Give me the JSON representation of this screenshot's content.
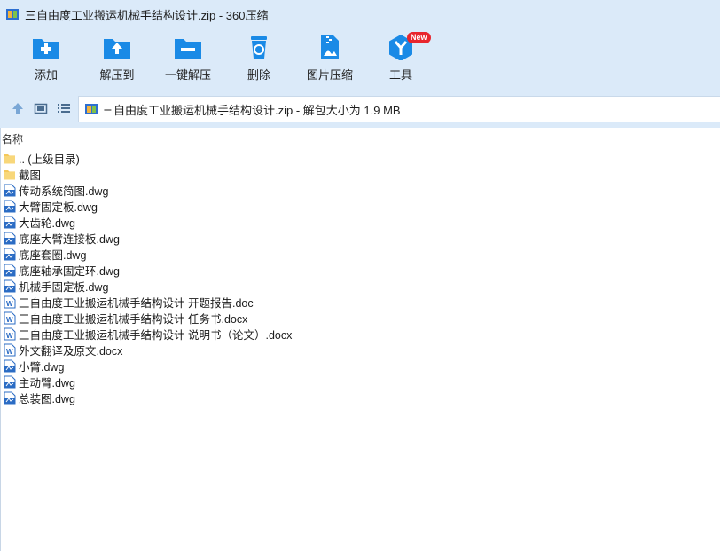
{
  "window": {
    "title": "三自由度工业搬运机械手结构设计.zip - 360压缩"
  },
  "toolbar": {
    "items": [
      {
        "label": "添加",
        "icon": "add-icon"
      },
      {
        "label": "解压到",
        "icon": "extract-to-icon"
      },
      {
        "label": "一键解压",
        "icon": "one-click-extract-icon"
      },
      {
        "label": "删除",
        "icon": "delete-icon"
      },
      {
        "label": "图片压缩",
        "icon": "image-compress-icon"
      },
      {
        "label": "工具",
        "icon": "tools-icon",
        "badge": "New"
      }
    ]
  },
  "address": {
    "text": "三自由度工业搬运机械手结构设计.zip - 解包大小为 1.9 MB"
  },
  "list": {
    "column_name": "名称",
    "files": [
      {
        "name": ".. (上级目录)",
        "type": "folder"
      },
      {
        "name": "截图",
        "type": "folder"
      },
      {
        "name": "传动系统简图.dwg",
        "type": "dwg"
      },
      {
        "name": "大臂固定板.dwg",
        "type": "dwg"
      },
      {
        "name": "大齿轮.dwg",
        "type": "dwg"
      },
      {
        "name": "底座大臂连接板.dwg",
        "type": "dwg"
      },
      {
        "name": "底座套圈.dwg",
        "type": "dwg"
      },
      {
        "name": "底座轴承固定环.dwg",
        "type": "dwg"
      },
      {
        "name": "机械手固定板.dwg",
        "type": "dwg"
      },
      {
        "name": "三自由度工业搬运机械手结构设计 开题报告.doc",
        "type": "word"
      },
      {
        "name": "三自由度工业搬运机械手结构设计 任务书.docx",
        "type": "word"
      },
      {
        "name": "三自由度工业搬运机械手结构设计 说明书（论文）.docx",
        "type": "word"
      },
      {
        "name": "外文翻译及原文.docx",
        "type": "word"
      },
      {
        "name": "小臂.dwg",
        "type": "dwg"
      },
      {
        "name": "主动臂.dwg",
        "type": "dwg"
      },
      {
        "name": "总装图.dwg",
        "type": "dwg"
      }
    ]
  },
  "colors": {
    "chrome": "#dbeaf9",
    "icon_blue": "#1a8ae6",
    "badge_red": "#e8262e",
    "folder": "#f5c85a"
  }
}
